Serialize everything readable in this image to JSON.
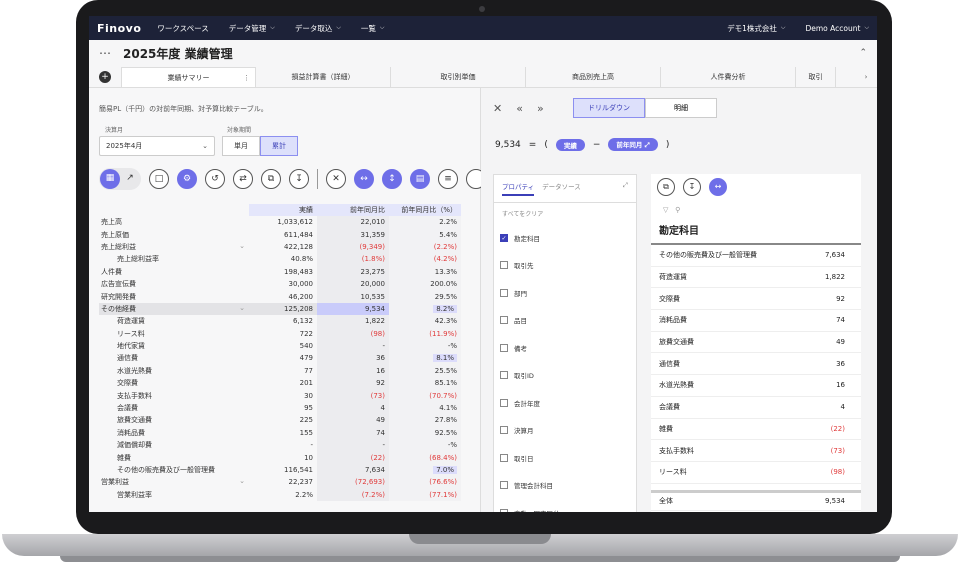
{
  "nav": {
    "brand": "Finovo",
    "items": [
      "ワークスペース",
      "データ管理",
      "データ取込",
      "一覧"
    ],
    "company": "デモ1株式会社",
    "account": "Demo Account"
  },
  "header": {
    "title": "2025年度 業績管理"
  },
  "tabs": [
    "業績サマリー",
    "損益計算書（詳細）",
    "取引別単価",
    "商品別売上高",
    "人件費分析",
    "取引"
  ],
  "left": {
    "description": "簡易PL（千円）の対前年同期、対予算比較テーブル。",
    "month_label": "決算月",
    "period_label": "対象期間",
    "month_value": "2025年4月",
    "period_options": [
      "単月",
      "累計"
    ]
  },
  "table": {
    "headers": [
      "実績",
      "前年同月比",
      "前年同月比（%）"
    ],
    "rows": [
      {
        "label": "売上高",
        "indent": 0,
        "actual": "1,033,612",
        "diff": "22,010",
        "pct": "2.2%"
      },
      {
        "label": "売上原価",
        "indent": 0,
        "actual": "611,484",
        "diff": "31,359",
        "pct": "5.4%"
      },
      {
        "label": "売上総利益",
        "indent": 0,
        "expand": true,
        "actual": "422,128",
        "diff": "(9,349)",
        "pct": "(2.2%)",
        "neg": true
      },
      {
        "label": "売上総利益率",
        "indent": 1,
        "actual": "40.8%",
        "diff": "(1.8%)",
        "pct": "(4.2%)",
        "neg": true
      },
      {
        "label": "人件費",
        "indent": 0,
        "actual": "198,483",
        "diff": "23,275",
        "pct": "13.3%"
      },
      {
        "label": "広告宣伝費",
        "indent": 0,
        "actual": "30,000",
        "diff": "20,000",
        "pct": "200.0%"
      },
      {
        "label": "研究開発費",
        "indent": 0,
        "actual": "46,200",
        "diff": "10,535",
        "pct": "29.5%"
      },
      {
        "label": "その他経費",
        "indent": 0,
        "expand": true,
        "selected": true,
        "actual": "125,208",
        "diff": "9,534",
        "pct": "8.2%",
        "hlpct": true
      },
      {
        "label": "荷造運賃",
        "indent": 1,
        "actual": "6,132",
        "diff": "1,822",
        "pct": "42.3%"
      },
      {
        "label": "リース料",
        "indent": 1,
        "actual": "722",
        "diff": "(98)",
        "pct": "(11.9%)",
        "neg": true
      },
      {
        "label": "地代家賃",
        "indent": 1,
        "actual": "540",
        "diff": "-",
        "pct": "-%"
      },
      {
        "label": "通信費",
        "indent": 1,
        "actual": "479",
        "diff": "36",
        "pct": "8.1%",
        "hlpct": true
      },
      {
        "label": "水道光熱費",
        "indent": 1,
        "actual": "77",
        "diff": "16",
        "pct": "25.5%"
      },
      {
        "label": "交際費",
        "indent": 1,
        "actual": "201",
        "diff": "92",
        "pct": "85.1%"
      },
      {
        "label": "支払手数料",
        "indent": 1,
        "actual": "30",
        "diff": "(73)",
        "pct": "(70.7%)",
        "neg": true
      },
      {
        "label": "会議費",
        "indent": 1,
        "actual": "95",
        "diff": "4",
        "pct": "4.1%"
      },
      {
        "label": "旅費交通費",
        "indent": 1,
        "actual": "225",
        "diff": "49",
        "pct": "27.8%"
      },
      {
        "label": "消耗品費",
        "indent": 1,
        "actual": "155",
        "diff": "74",
        "pct": "92.5%"
      },
      {
        "label": "減価償却費",
        "indent": 1,
        "actual": "-",
        "diff": "-",
        "pct": "-%"
      },
      {
        "label": "雑費",
        "indent": 1,
        "actual": "10",
        "diff": "(22)",
        "pct": "(68.4%)",
        "neg": true
      },
      {
        "label": "その他の販売費及び一般管理費",
        "indent": 1,
        "actual": "116,541",
        "diff": "7,634",
        "pct": "7.0%",
        "hlpct": true
      },
      {
        "label": "営業利益",
        "indent": 0,
        "expand": true,
        "actual": "22,237",
        "diff": "(72,693)",
        "pct": "(76.6%)",
        "neg": true
      },
      {
        "label": "営業利益率",
        "indent": 1,
        "actual": "2.2%",
        "diff": "(7.2%)",
        "pct": "(77.1%)",
        "neg": true
      }
    ]
  },
  "right": {
    "modes": [
      "ドリルダウン",
      "明細"
    ],
    "formula": {
      "value": "9,534",
      "eq": "=",
      "open": "(",
      "term1": "実績",
      "minus": "−",
      "term2": "前年同月",
      "close": ")"
    },
    "prop_tabs": [
      "プロパティ",
      "データソース"
    ],
    "clear_all": "すべてをクリア",
    "properties": [
      {
        "label": "勘定科目",
        "checked": true
      },
      {
        "label": "取引先",
        "checked": false
      },
      {
        "label": "部門",
        "checked": false
      },
      {
        "label": "品目",
        "checked": false
      },
      {
        "label": "備考",
        "checked": false
      },
      {
        "label": "取引ID",
        "checked": false
      },
      {
        "label": "会計年度",
        "checked": false
      },
      {
        "label": "決算月",
        "checked": false
      },
      {
        "label": "取引日",
        "checked": false
      },
      {
        "label": "管理会計科目",
        "checked": false
      },
      {
        "label": "変動・固定区分",
        "checked": false
      }
    ],
    "breakdown": {
      "title": "勘定科目",
      "rows": [
        {
          "label": "その他の販売費及び一般管理費",
          "value": "7,634"
        },
        {
          "label": "荷造運賃",
          "value": "1,822"
        },
        {
          "label": "交際費",
          "value": "92"
        },
        {
          "label": "消耗品費",
          "value": "74"
        },
        {
          "label": "旅費交通費",
          "value": "49"
        },
        {
          "label": "通信費",
          "value": "36"
        },
        {
          "label": "水道光熱費",
          "value": "16"
        },
        {
          "label": "会議費",
          "value": "4"
        },
        {
          "label": "雑費",
          "value": "(22)",
          "neg": true
        },
        {
          "label": "支払手数料",
          "value": "(73)",
          "neg": true
        },
        {
          "label": "リース料",
          "value": "(98)",
          "neg": true
        }
      ],
      "total_label": "全体",
      "total_value": "9,534"
    }
  }
}
